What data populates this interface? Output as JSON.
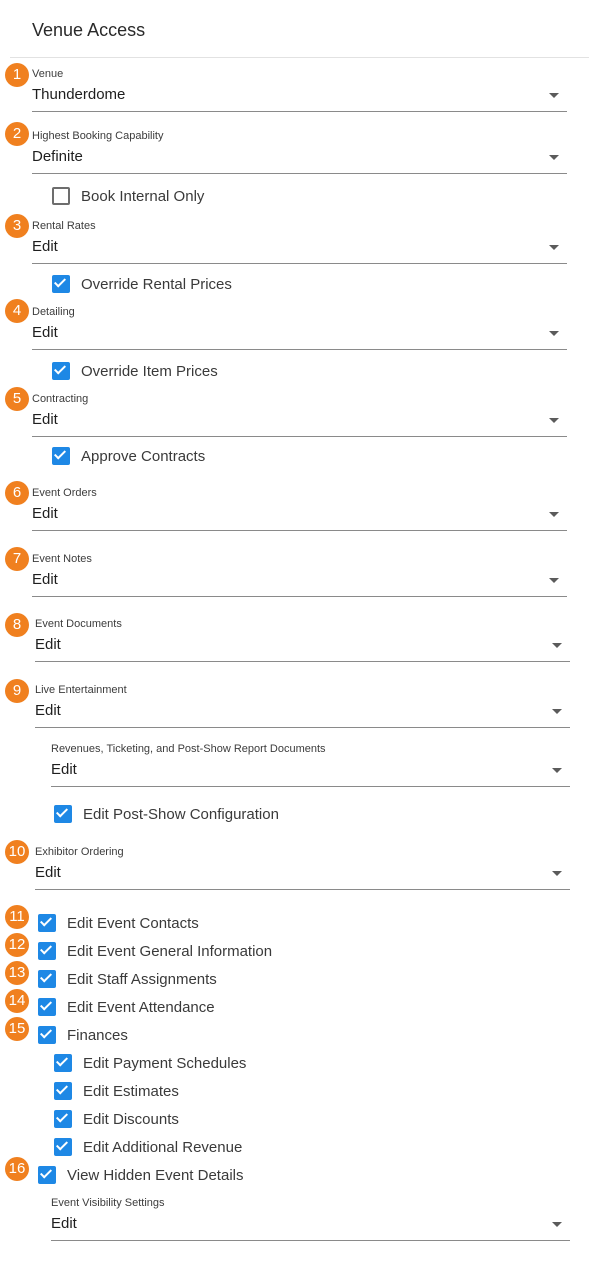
{
  "page": {
    "title": "Venue Access"
  },
  "badges": [
    "1",
    "2",
    "3",
    "4",
    "5",
    "6",
    "7",
    "8",
    "9",
    "10",
    "11",
    "12",
    "13",
    "14",
    "15",
    "16"
  ],
  "fields": {
    "venue": {
      "label": "Venue",
      "value": "Thunderdome"
    },
    "booking": {
      "label": "Highest Booking Capability",
      "value": "Definite"
    },
    "rental_rates": {
      "label": "Rental Rates",
      "value": "Edit"
    },
    "detailing": {
      "label": "Detailing",
      "value": "Edit"
    },
    "contracting": {
      "label": "Contracting",
      "value": "Edit"
    },
    "event_orders": {
      "label": "Event Orders",
      "value": "Edit"
    },
    "event_notes": {
      "label": "Event Notes",
      "value": "Edit"
    },
    "event_documents": {
      "label": "Event Documents",
      "value": "Edit"
    },
    "live_entertainment": {
      "label": "Live Entertainment",
      "value": "Edit"
    },
    "revenues": {
      "label": "Revenues, Ticketing, and Post-Show Report Documents",
      "value": "Edit"
    },
    "exhibitor_ordering": {
      "label": "Exhibitor Ordering",
      "value": "Edit"
    },
    "event_visibility": {
      "label": "Event Visibility Settings",
      "value": "Edit"
    }
  },
  "checks": {
    "book_internal_only": {
      "label": "Book Internal Only",
      "checked": false
    },
    "override_rental_prices": {
      "label": "Override Rental Prices",
      "checked": true
    },
    "override_item_prices": {
      "label": "Override Item Prices",
      "checked": true
    },
    "approve_contracts": {
      "label": "Approve Contracts",
      "checked": true
    },
    "edit_post_show": {
      "label": "Edit Post-Show Configuration",
      "checked": true
    },
    "edit_event_contacts": {
      "label": "Edit Event Contacts",
      "checked": true
    },
    "edit_event_general": {
      "label": "Edit Event General Information",
      "checked": true
    },
    "edit_staff_assignments": {
      "label": "Edit Staff Assignments",
      "checked": true
    },
    "edit_event_attendance": {
      "label": "Edit Event Attendance",
      "checked": true
    },
    "finances": {
      "label": "Finances",
      "checked": true
    },
    "edit_payment_schedules": {
      "label": "Edit Payment Schedules",
      "checked": true
    },
    "edit_estimates": {
      "label": "Edit Estimates",
      "checked": true
    },
    "edit_discounts": {
      "label": "Edit Discounts",
      "checked": true
    },
    "edit_additional_revenue": {
      "label": "Edit Additional Revenue",
      "checked": true
    },
    "view_hidden_details": {
      "label": "View Hidden Event Details",
      "checked": true
    }
  },
  "colors": {
    "badge": "#f0801f",
    "checkbox": "#1e88e5"
  }
}
